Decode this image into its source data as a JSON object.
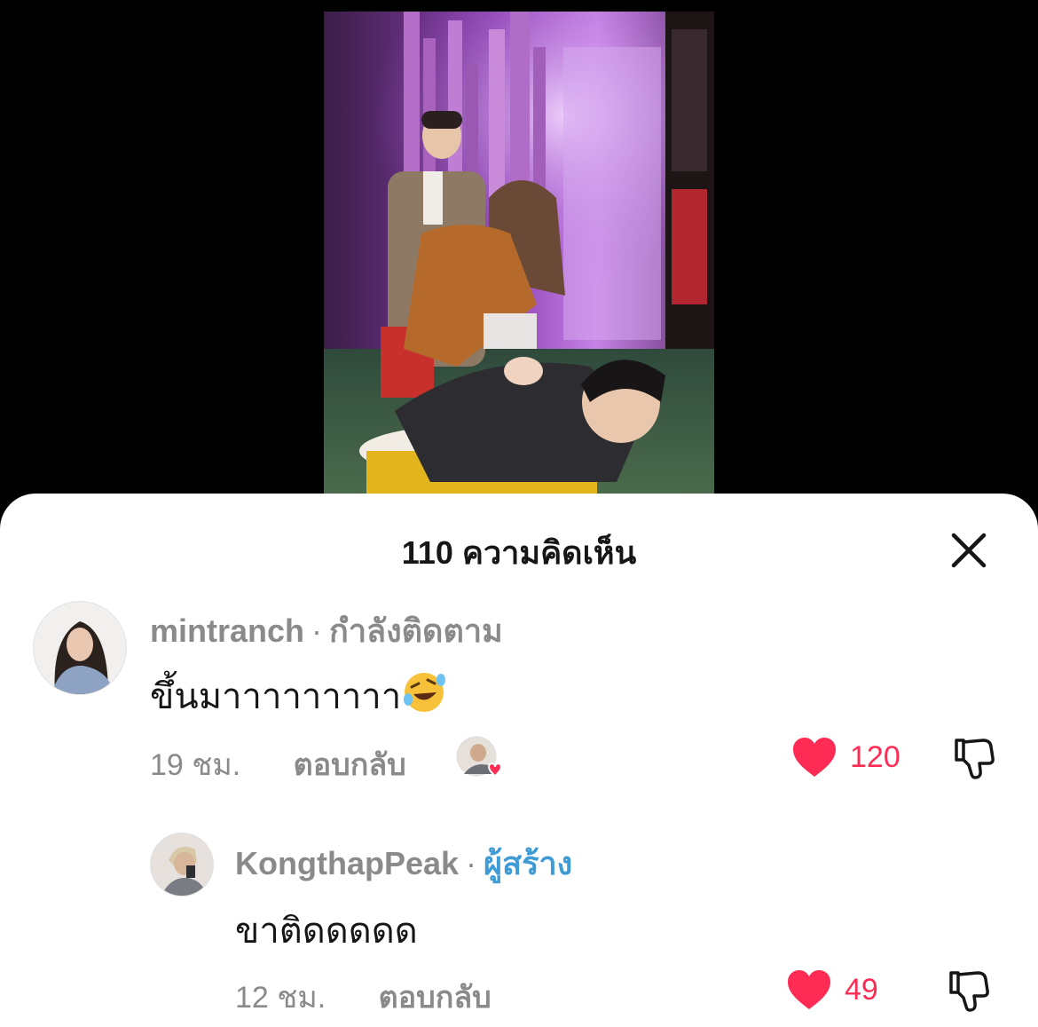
{
  "sheet": {
    "title": "110 ความคิดเห็น"
  },
  "comments": [
    {
      "username": "mintranch",
      "separator": "·",
      "badge": "กำลังติดตาม",
      "text": "ขึ้นมาาาาาาาาา",
      "emoji": "rolling-on-floor-laughing",
      "time": "19 ชม.",
      "reply_label": "ตอบกลับ",
      "likes": "120",
      "liked_by_creator": true
    },
    {
      "username": "KongthapPeak",
      "separator": "·",
      "badge": "ผู้สร้าง",
      "text": "ขาติดดดดด",
      "time": "12 ชม.",
      "reply_label": "ตอบกลับ",
      "likes": "49"
    }
  ],
  "colors": {
    "like": "#fe2c55",
    "creator_badge": "#3e9bd6",
    "meta_gray": "#8a8a8a",
    "text_dark": "#161616"
  },
  "icons": {
    "close": "close-icon",
    "like": "heart-icon",
    "dislike": "thumbs-down-icon"
  }
}
